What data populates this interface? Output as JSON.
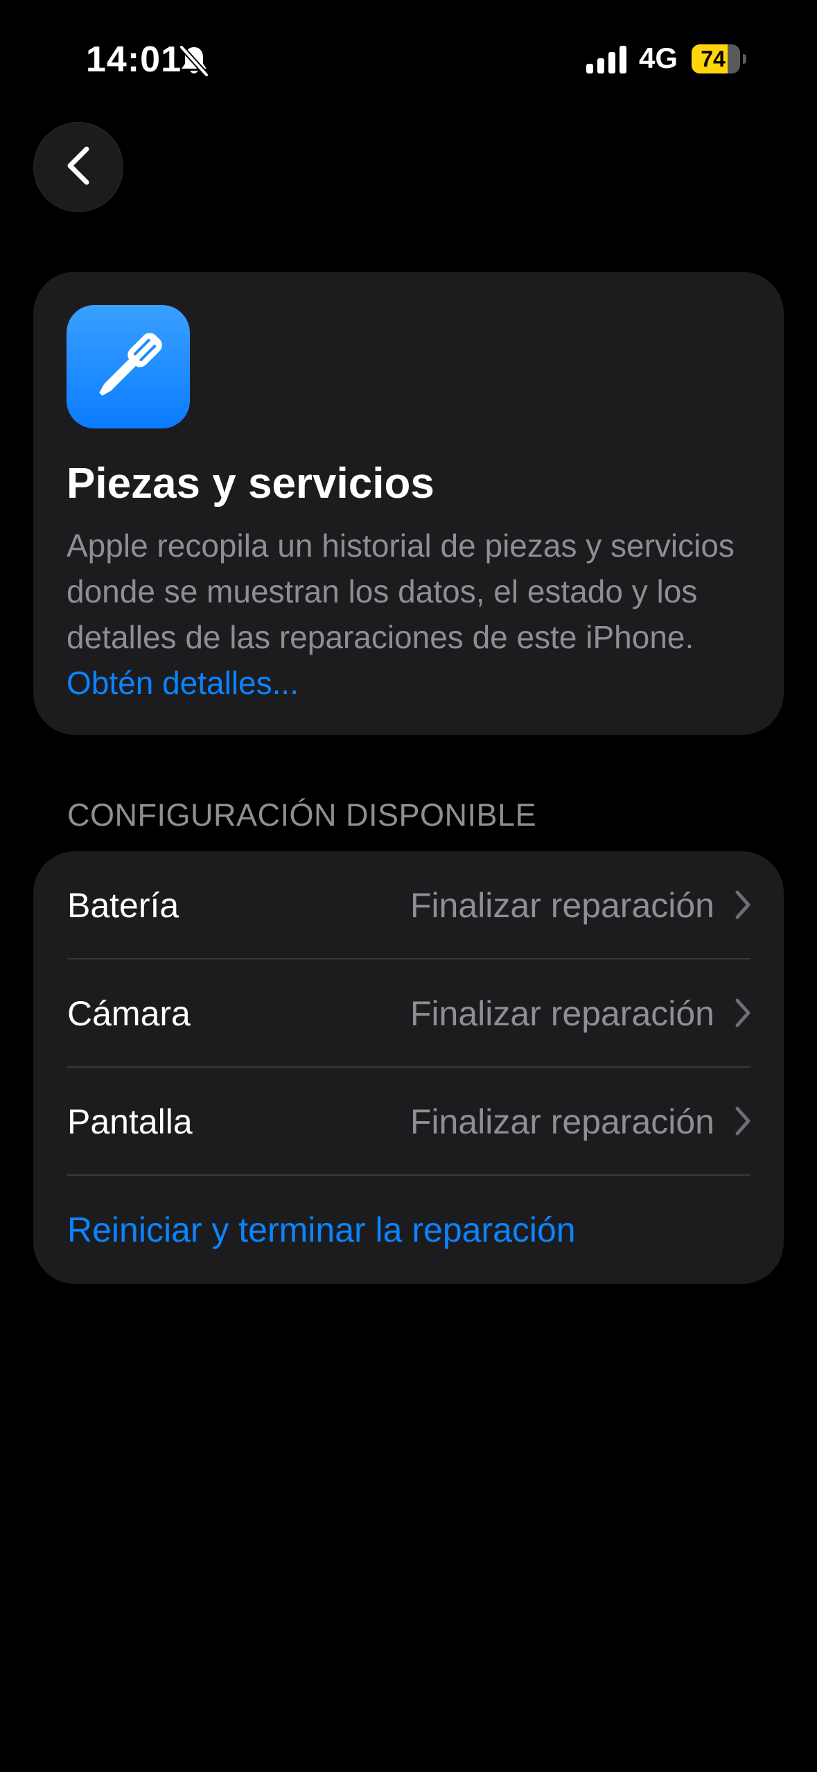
{
  "status_bar": {
    "time": "14:01",
    "network": "4G",
    "battery_level": "74",
    "battery_fraction": 0.74,
    "battery_color": "#ffd60a",
    "silent_icon": "bell-slash-icon",
    "signal_icon": "cellular-signal-icon"
  },
  "nav": {
    "back_icon": "chevron-left-icon"
  },
  "info_card": {
    "icon": "screwdriver-icon",
    "icon_color": "#0a7cff",
    "title": "Piezas y servicios",
    "description": "Apple recopila un historial de piezas y servicios donde se muestran los datos, el estado y los detalles de las reparaciones de este iPhone.",
    "link": "Obtén detalles..."
  },
  "section": {
    "header": "CONFIGURACIÓN DISPONIBLE",
    "rows": [
      {
        "label": "Batería",
        "value": "Finalizar reparación"
      },
      {
        "label": "Cámara",
        "value": "Finalizar reparación"
      },
      {
        "label": "Pantalla",
        "value": "Finalizar reparación"
      }
    ],
    "action": "Reiniciar y terminar la reparación"
  },
  "colors": {
    "accent": "#0a84ff",
    "background": "#000000",
    "card": "#1c1c1e",
    "secondary_text": "#8e8e93"
  }
}
